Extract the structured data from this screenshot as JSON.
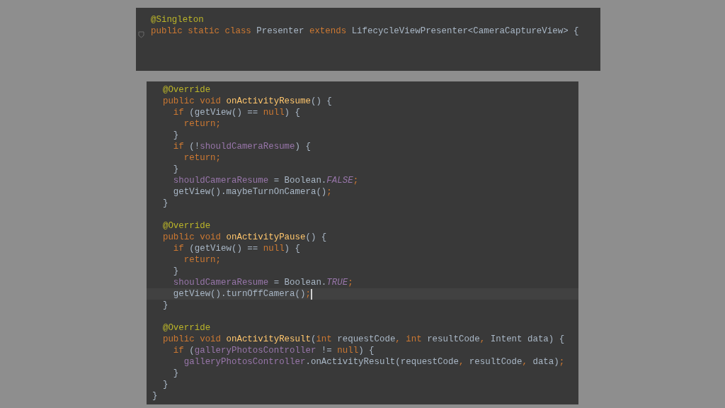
{
  "panels": [
    {
      "fold_marker": true,
      "lines": [
        {
          "kind": "code",
          "segments": [
            {
              "kind": "annotation",
              "text": "@Singleton"
            }
          ]
        },
        {
          "kind": "code",
          "segments": [
            {
              "kind": "keyword",
              "text": "public static class "
            },
            {
              "kind": "plain",
              "text": "Presenter "
            },
            {
              "kind": "keyword",
              "text": "extends "
            },
            {
              "kind": "plain",
              "text": "LifecycleViewPresenter<CameraCaptureView> {"
            }
          ]
        },
        {
          "kind": "blank"
        },
        {
          "kind": "blank"
        }
      ]
    },
    {
      "fold_marker": false,
      "lines": [
        {
          "kind": "code",
          "segments": [
            {
              "kind": "annotation",
              "text": "  @Override"
            }
          ]
        },
        {
          "kind": "code",
          "segments": [
            {
              "kind": "keyword",
              "text": "  public void "
            },
            {
              "kind": "method",
              "text": "onActivityResume"
            },
            {
              "kind": "plain",
              "text": "() {"
            }
          ]
        },
        {
          "kind": "code",
          "segments": [
            {
              "kind": "keyword",
              "text": "    if "
            },
            {
              "kind": "plain",
              "text": "(getView() == "
            },
            {
              "kind": "keyword",
              "text": "null"
            },
            {
              "kind": "plain",
              "text": ") {"
            }
          ]
        },
        {
          "kind": "code",
          "segments": [
            {
              "kind": "keyword",
              "text": "      return;"
            }
          ]
        },
        {
          "kind": "code",
          "segments": [
            {
              "kind": "plain",
              "text": "    }"
            }
          ]
        },
        {
          "kind": "code",
          "segments": [
            {
              "kind": "keyword",
              "text": "    if "
            },
            {
              "kind": "plain",
              "text": "(!"
            },
            {
              "kind": "field",
              "text": "shouldCameraResume"
            },
            {
              "kind": "plain",
              "text": ") {"
            }
          ]
        },
        {
          "kind": "code",
          "segments": [
            {
              "kind": "keyword",
              "text": "      return;"
            }
          ]
        },
        {
          "kind": "code",
          "segments": [
            {
              "kind": "plain",
              "text": "    }"
            }
          ]
        },
        {
          "kind": "code",
          "segments": [
            {
              "kind": "field",
              "text": "    shouldCameraResume"
            },
            {
              "kind": "plain",
              "text": " = Boolean."
            },
            {
              "kind": "constant",
              "text": "FALSE"
            },
            {
              "kind": "keyword",
              "text": ";"
            }
          ]
        },
        {
          "kind": "code",
          "segments": [
            {
              "kind": "plain",
              "text": "    getView().maybeTurnOnCamera()"
            },
            {
              "kind": "keyword",
              "text": ";"
            }
          ]
        },
        {
          "kind": "code",
          "segments": [
            {
              "kind": "plain",
              "text": "  }"
            }
          ]
        },
        {
          "kind": "blank"
        },
        {
          "kind": "code",
          "segments": [
            {
              "kind": "annotation",
              "text": "  @Override"
            }
          ]
        },
        {
          "kind": "code",
          "segments": [
            {
              "kind": "keyword",
              "text": "  public void "
            },
            {
              "kind": "method",
              "text": "onActivityPause"
            },
            {
              "kind": "plain",
              "text": "() {"
            }
          ]
        },
        {
          "kind": "code",
          "segments": [
            {
              "kind": "keyword",
              "text": "    if "
            },
            {
              "kind": "plain",
              "text": "(getView() == "
            },
            {
              "kind": "keyword",
              "text": "null"
            },
            {
              "kind": "plain",
              "text": ") {"
            }
          ]
        },
        {
          "kind": "code",
          "segments": [
            {
              "kind": "keyword",
              "text": "      return;"
            }
          ]
        },
        {
          "kind": "code",
          "segments": [
            {
              "kind": "plain",
              "text": "    }"
            }
          ]
        },
        {
          "kind": "code",
          "segments": [
            {
              "kind": "field",
              "text": "    shouldCameraResume"
            },
            {
              "kind": "plain",
              "text": " = Boolean."
            },
            {
              "kind": "constant",
              "text": "TRUE"
            },
            {
              "kind": "keyword",
              "text": ";"
            }
          ]
        },
        {
          "kind": "code",
          "caret": true,
          "segments": [
            {
              "kind": "plain",
              "text": "    getView().turnOffCamera()"
            },
            {
              "kind": "keyword",
              "text": ";"
            }
          ]
        },
        {
          "kind": "code",
          "segments": [
            {
              "kind": "plain",
              "text": "  }"
            }
          ]
        },
        {
          "kind": "blank"
        },
        {
          "kind": "code",
          "segments": [
            {
              "kind": "annotation",
              "text": "  @Override"
            }
          ]
        },
        {
          "kind": "code",
          "segments": [
            {
              "kind": "keyword",
              "text": "  public void "
            },
            {
              "kind": "method",
              "text": "onActivityResult"
            },
            {
              "kind": "plain",
              "text": "("
            },
            {
              "kind": "keyword",
              "text": "int "
            },
            {
              "kind": "plain",
              "text": "requestCode"
            },
            {
              "kind": "keyword",
              "text": ", int "
            },
            {
              "kind": "plain",
              "text": "resultCode"
            },
            {
              "kind": "keyword",
              "text": ", "
            },
            {
              "kind": "plain",
              "text": "Intent data) {"
            }
          ]
        },
        {
          "kind": "code",
          "segments": [
            {
              "kind": "keyword",
              "text": "    if "
            },
            {
              "kind": "plain",
              "text": "("
            },
            {
              "kind": "field",
              "text": "galleryPhotosController "
            },
            {
              "kind": "plain",
              "text": "!= "
            },
            {
              "kind": "keyword",
              "text": "null"
            },
            {
              "kind": "plain",
              "text": ") {"
            }
          ]
        },
        {
          "kind": "code",
          "segments": [
            {
              "kind": "field",
              "text": "      galleryPhotosController"
            },
            {
              "kind": "plain",
              "text": ".onActivityResult(requestCode"
            },
            {
              "kind": "keyword",
              "text": ", "
            },
            {
              "kind": "plain",
              "text": "resultCode"
            },
            {
              "kind": "keyword",
              "text": ", "
            },
            {
              "kind": "plain",
              "text": "data)"
            },
            {
              "kind": "keyword",
              "text": ";"
            }
          ]
        },
        {
          "kind": "code",
          "segments": [
            {
              "kind": "plain",
              "text": "    }"
            }
          ]
        },
        {
          "kind": "code",
          "segments": [
            {
              "kind": "plain",
              "text": "  }"
            }
          ]
        },
        {
          "kind": "code",
          "segments": [
            {
              "kind": "plain",
              "text": "}"
            }
          ]
        }
      ]
    }
  ]
}
